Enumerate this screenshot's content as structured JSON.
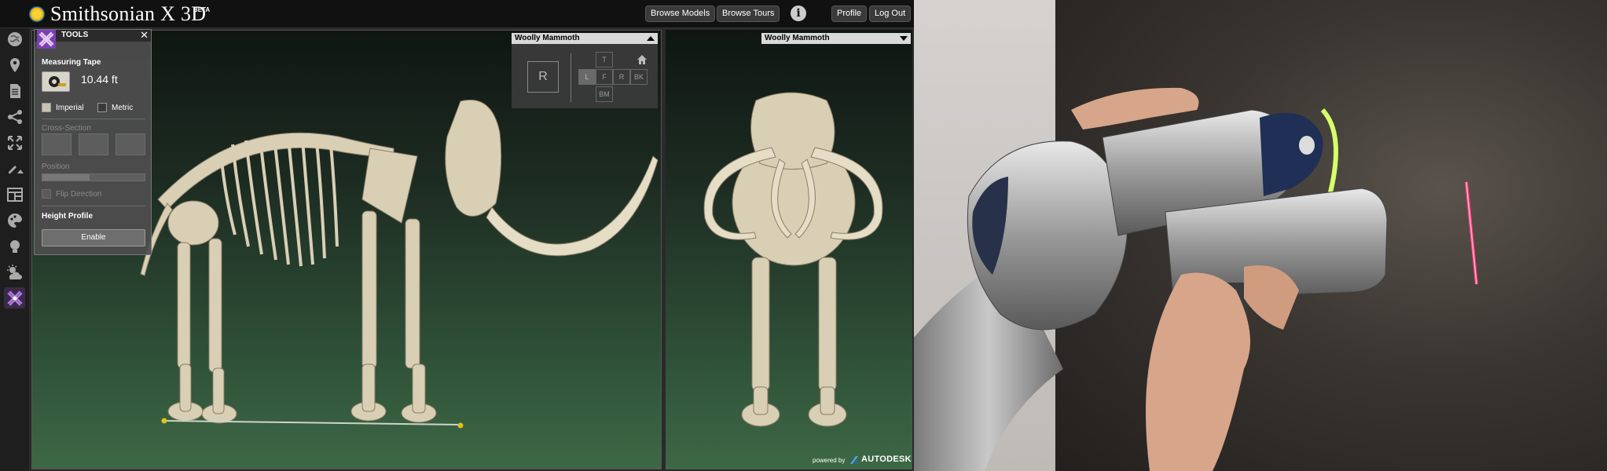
{
  "header": {
    "brand": "Smithsonian X 3D",
    "beta": "BETA",
    "nav": [
      {
        "label": "Browse Models"
      },
      {
        "label": "Browse Tours"
      }
    ],
    "profile_label": "Profile",
    "logout_label": "Log Out"
  },
  "sidebar": {
    "icons": [
      "globe-icon",
      "map-pin-icon",
      "document-icon",
      "share-icon",
      "fullscreen-icon",
      "pencil-icon",
      "layout-icon",
      "color-palette-icon",
      "lightbulb-icon",
      "environment-icon",
      "tools-icon"
    ]
  },
  "tools_panel": {
    "title": "TOOLS",
    "measuring_tape_label": "Measuring Tape",
    "measurement_value": "10.44 ft",
    "unit_imperial_label": "Imperial",
    "unit_metric_label": "Metric",
    "selected_unit": "Imperial",
    "cross_section_label": "Cross-Section",
    "position_label": "Position",
    "flip_direction_label": "Flip Direction",
    "height_profile_label": "Height Profile",
    "enable_button_label": "Enable"
  },
  "main_view": {
    "model_select_value": "Woolly Mammoth",
    "view_reset_label": "R",
    "view_top_label": "T",
    "view_left_label": "L",
    "view_front_label": "F",
    "view_right_label": "R",
    "view_back_label": "BK",
    "view_bottom_label": "BM"
  },
  "side_view": {
    "model_select_value": "Woolly Mammoth"
  },
  "footer": {
    "powered_by": "powered by",
    "vendor": "AUTODESK"
  },
  "colors": {
    "accent_tools": "#7b3fb5",
    "viewport_green": "#3d6845",
    "bone": "#d9cfb5"
  }
}
